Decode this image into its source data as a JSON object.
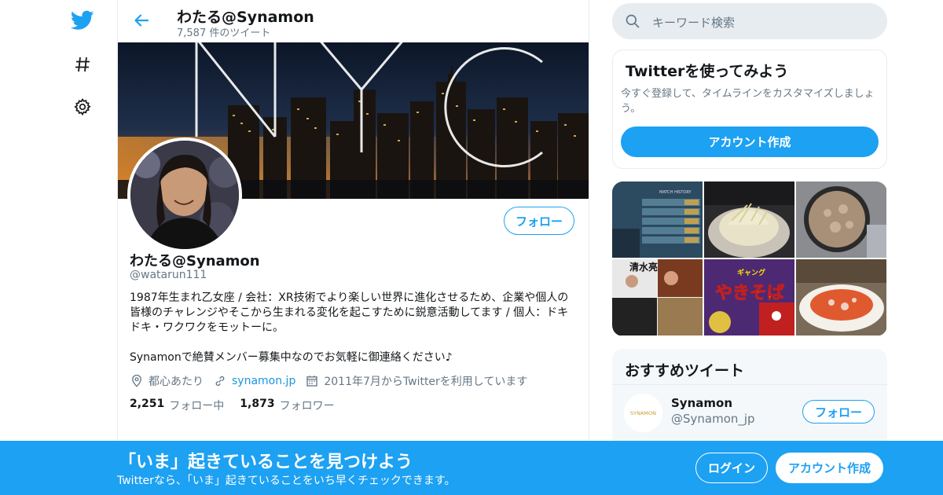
{
  "profile_header": {
    "name": "わたる@Synamon",
    "tweet_count": "7,587 件のツイート"
  },
  "profile": {
    "name": "わたる@Synamon",
    "handle": "@watarun111",
    "follow_label": "フォロー",
    "bio_line1": "1987年生まれ乙女座 / 会社：XR技術でより楽しい世界に進化させるため、企業や個人の皆様のチャレンジやそこから生まれる変化を起こすために鋭意活動してます / 個人：ドキドキ・ワクワクをモットーに。",
    "bio_line2": "Synamonで絶賛メンバー募集中なのでお気軽に御連絡ください♪",
    "location": "都心あたり",
    "website": "synamon.jp",
    "joined": "2011年7月からTwitterを利用しています",
    "following_count": "2,251",
    "following_label": "フォロー中",
    "followers_count": "1,873",
    "followers_label": "フォロワー"
  },
  "banner": {
    "text": "NYC"
  },
  "search": {
    "placeholder": "キーワード検索"
  },
  "signup_card": {
    "title": "Twitterを使ってみよう",
    "desc": "今すぐ登録して、タイムラインをカスタマイズしましょう。",
    "button": "アカウント作成"
  },
  "media": {
    "tile1_text": "MATCH HISTORY",
    "tile5_text": "やきそば",
    "tile5_sub": "ギャング",
    "tile4_text": "清水亮"
  },
  "recommended": {
    "title": "おすすめツイート",
    "name": "Synamon",
    "handle": "@Synamon_jp",
    "button": "フォロー",
    "logo_text": "SYNAMON"
  },
  "bottom_bar": {
    "headline": "「いま」起きていることを見つけよう",
    "sub": "Twitterなら、「いま」起きていることをいち早くチェックできます。",
    "login": "ログイン",
    "signup": "アカウント作成"
  },
  "colors": {
    "accent": "#1da1f2",
    "text": "#14171a",
    "muted": "#657786",
    "border": "#e6ecf0"
  },
  "icons": [
    "twitter-bird-icon",
    "hashtag-icon",
    "gear-icon",
    "back-arrow-icon",
    "search-icon",
    "location-icon",
    "link-icon",
    "calendar-icon"
  ]
}
